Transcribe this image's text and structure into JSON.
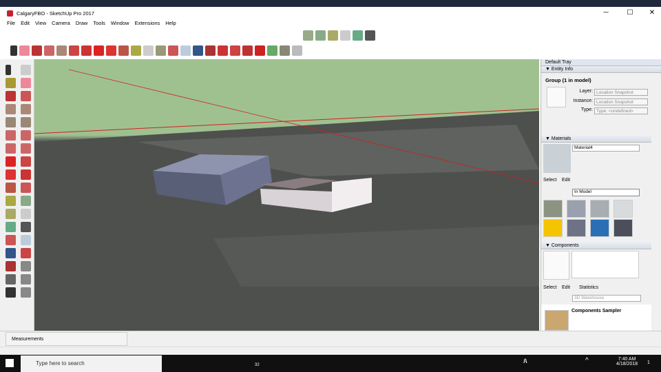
{
  "window": {
    "title": "CalgaryFBO - SketchUp Pro 2017",
    "min": "─",
    "max": "☐",
    "close": "✕"
  },
  "menu": [
    "File",
    "Edit",
    "View",
    "Camera",
    "Draw",
    "Tools",
    "Window",
    "Extensions",
    "Help"
  ],
  "tray": {
    "title": "Default Tray",
    "entity_info": {
      "header": "Entity Info",
      "heading": "Group (1 in model)",
      "layer_label": "Layer:",
      "layer_value": "Location Snapshot",
      "instance_label": "Instance:",
      "instance_value": "Location Snapshot",
      "type_label": "Type:",
      "type_value": "Type: <undefined>"
    },
    "materials": {
      "header": "Materials",
      "name": "Material4",
      "tab_select": "Select",
      "tab_edit": "Edit",
      "collection": "In Model"
    },
    "components": {
      "header": "Components",
      "tab_select": "Select",
      "tab_edit": "Edit",
      "tab_statistics": "Statistics",
      "search_placeholder": "3D Warehouse",
      "item_title": "Components Sampler"
    }
  },
  "status": {
    "measurements_label": "Measurements"
  },
  "taskbar": {
    "search_placeholder": "Type here to search",
    "time": "7:40 AM",
    "date": "4/18/2018",
    "notification_count": "1",
    "badge": "32"
  },
  "colors": {
    "sky": "#9fc190",
    "axis_red": "#d02020",
    "sketchup_red": "#c8202f"
  }
}
